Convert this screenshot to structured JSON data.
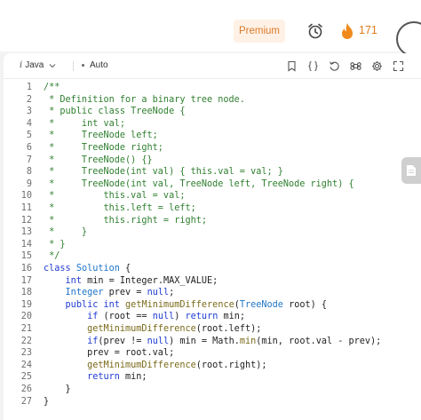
{
  "header": {
    "premium_label": "Premium",
    "streak_count": "171",
    "icons": [
      "alarm-clock-icon",
      "flame-icon",
      "avatar"
    ]
  },
  "toolbar": {
    "language": "Java",
    "language_prefix": "i",
    "mode": "Auto",
    "icons": [
      "bookmark-icon",
      "braces-icon",
      "reset-icon",
      "command-icon",
      "settings-icon",
      "expand-icon"
    ]
  },
  "colors": {
    "comment": "#2f7f2f",
    "keyword": "#1f3cd1",
    "type": "#1f75c9",
    "function": "#7a6a1a",
    "accent": "#e07b1a"
  },
  "code": {
    "lines": [
      {
        "n": "1",
        "t": [
          [
            "cm",
            "/**"
          ]
        ]
      },
      {
        "n": "2",
        "t": [
          [
            "cm",
            " * Definition for a binary tree node."
          ]
        ]
      },
      {
        "n": "3",
        "t": [
          [
            "cm",
            " * public class TreeNode {"
          ]
        ]
      },
      {
        "n": "4",
        "t": [
          [
            "cm",
            " *     int val;"
          ]
        ]
      },
      {
        "n": "5",
        "t": [
          [
            "cm",
            " *     TreeNode left;"
          ]
        ]
      },
      {
        "n": "6",
        "t": [
          [
            "cm",
            " *     TreeNode right;"
          ]
        ]
      },
      {
        "n": "7",
        "t": [
          [
            "cm",
            " *     TreeNode() {}"
          ]
        ]
      },
      {
        "n": "8",
        "t": [
          [
            "cm",
            " *     TreeNode(int val) { this.val = val; }"
          ]
        ]
      },
      {
        "n": "9",
        "t": [
          [
            "cm",
            " *     TreeNode(int val, TreeNode left, TreeNode right) {"
          ]
        ]
      },
      {
        "n": "10",
        "t": [
          [
            "cm",
            " *         this.val = val;"
          ]
        ]
      },
      {
        "n": "11",
        "t": [
          [
            "cm",
            " *         this.left = left;"
          ]
        ]
      },
      {
        "n": "12",
        "t": [
          [
            "cm",
            " *         this.right = right;"
          ]
        ]
      },
      {
        "n": "13",
        "t": [
          [
            "cm",
            " *     }"
          ]
        ]
      },
      {
        "n": "14",
        "t": [
          [
            "cm",
            " * }"
          ]
        ]
      },
      {
        "n": "15",
        "t": [
          [
            "cm",
            " */"
          ]
        ]
      },
      {
        "n": "16",
        "t": [
          [
            "kw",
            "class"
          ],
          [
            "pl",
            " "
          ],
          [
            "ty",
            "Solution"
          ],
          [
            "pl",
            " {"
          ]
        ]
      },
      {
        "n": "17",
        "t": [
          [
            "pl",
            "    "
          ],
          [
            "kw",
            "int"
          ],
          [
            "pl",
            " min = Integer.MAX_VALUE;"
          ]
        ]
      },
      {
        "n": "18",
        "t": [
          [
            "pl",
            "    "
          ],
          [
            "ty",
            "Integer"
          ],
          [
            "pl",
            " prev = "
          ],
          [
            "kw",
            "null"
          ],
          [
            "pl",
            ";"
          ]
        ]
      },
      {
        "n": "19",
        "t": [
          [
            "pl",
            "    "
          ],
          [
            "kw",
            "public"
          ],
          [
            "pl",
            " "
          ],
          [
            "kw",
            "int"
          ],
          [
            "pl",
            " "
          ],
          [
            "fn",
            "getMinimumDifference"
          ],
          [
            "pl",
            "("
          ],
          [
            "ty",
            "TreeNode"
          ],
          [
            "pl",
            " root) {"
          ]
        ]
      },
      {
        "n": "20",
        "t": [
          [
            "pl",
            "        "
          ],
          [
            "kw",
            "if"
          ],
          [
            "pl",
            " (root == "
          ],
          [
            "kw",
            "null"
          ],
          [
            "pl",
            ") "
          ],
          [
            "kw",
            "return"
          ],
          [
            "pl",
            " min;"
          ]
        ]
      },
      {
        "n": "21",
        "t": [
          [
            "pl",
            "        "
          ],
          [
            "fn",
            "getMinimumDifference"
          ],
          [
            "pl",
            "(root.left);"
          ]
        ]
      },
      {
        "n": "22",
        "t": [
          [
            "pl",
            "        "
          ],
          [
            "kw",
            "if"
          ],
          [
            "pl",
            "(prev != "
          ],
          [
            "kw",
            "null"
          ],
          [
            "pl",
            ") min = Math."
          ],
          [
            "fn",
            "min"
          ],
          [
            "pl",
            "(min, root.val - prev);"
          ]
        ]
      },
      {
        "n": "23",
        "t": [
          [
            "pl",
            "        prev = root.val;"
          ]
        ]
      },
      {
        "n": "24",
        "t": [
          [
            "pl",
            "        "
          ],
          [
            "fn",
            "getMinimumDifference"
          ],
          [
            "pl",
            "(root.right);"
          ]
        ]
      },
      {
        "n": "25",
        "t": [
          [
            "pl",
            "        "
          ],
          [
            "kw",
            "return"
          ],
          [
            "pl",
            " min;"
          ]
        ]
      },
      {
        "n": "26",
        "t": [
          [
            "pl",
            "    }"
          ]
        ]
      },
      {
        "n": "27",
        "t": [
          [
            "pl",
            "}"
          ]
        ]
      }
    ]
  }
}
